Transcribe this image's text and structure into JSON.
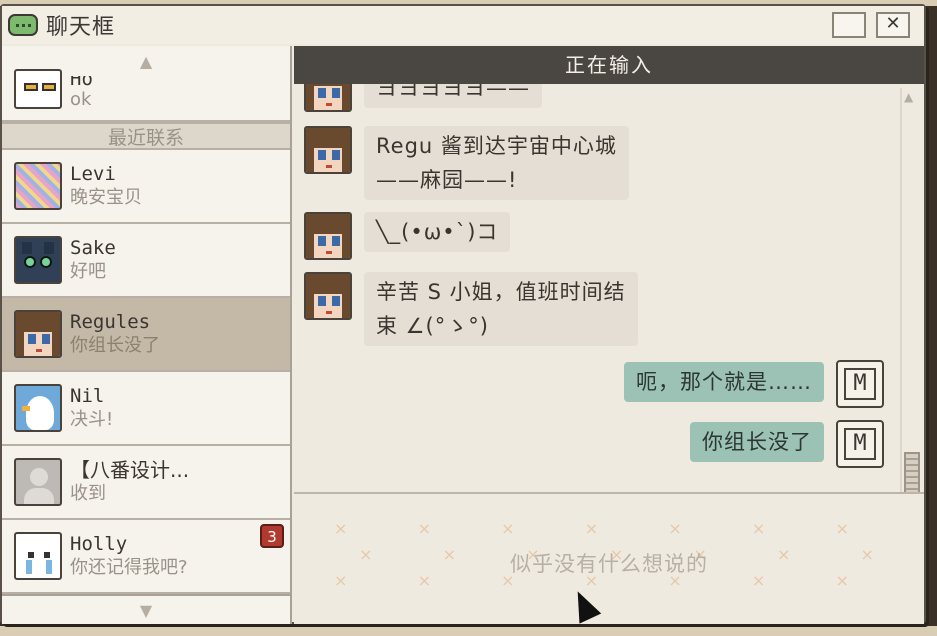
{
  "window": {
    "title": "聊天框",
    "close_label": "✕"
  },
  "sidebar": {
    "section_label": "最近联系",
    "partial_contact": {
      "name": "Ho",
      "last_message": "ok"
    },
    "contacts": [
      {
        "name": "Levi",
        "last_message": "晚安宝贝",
        "active": false
      },
      {
        "name": "Sake",
        "last_message": "好吧",
        "active": false
      },
      {
        "name": "Regules",
        "last_message": "你组长没了",
        "active": true
      },
      {
        "name": "Nil",
        "last_message": "决斗!",
        "active": false
      },
      {
        "name": "【八番设计...",
        "last_message": "收到",
        "active": false
      },
      {
        "name": "Holly",
        "last_message": "你还记得我吧?",
        "active": false,
        "unread": "3"
      }
    ]
  },
  "chat": {
    "status": "正在输入",
    "messages": [
      {
        "from": "contact",
        "lines": [
          "ヨヨヨヨヨ——"
        ]
      },
      {
        "from": "contact",
        "lines": [
          "Regu 酱到达宇宙中心城",
          "——麻园——!"
        ]
      },
      {
        "from": "contact",
        "lines": [
          "╲_(•ω•`)コ"
        ]
      },
      {
        "from": "contact",
        "lines": [
          "辛苦 S 小姐，值班时间结",
          "束 ∠(°ゝ°)"
        ]
      },
      {
        "from": "me",
        "lines": [
          "呃，那个就是……"
        ]
      },
      {
        "from": "me",
        "lines": [
          "你组长没了"
        ]
      }
    ],
    "input_placeholder": "似乎没有什么想说的",
    "my_icon_glyph": "M"
  },
  "colors": {
    "accent_out_bubble": "#9cc2b6",
    "in_bubble": "#e4ded4",
    "header": "#4a4642",
    "unread_badge": "#b03a2e"
  }
}
